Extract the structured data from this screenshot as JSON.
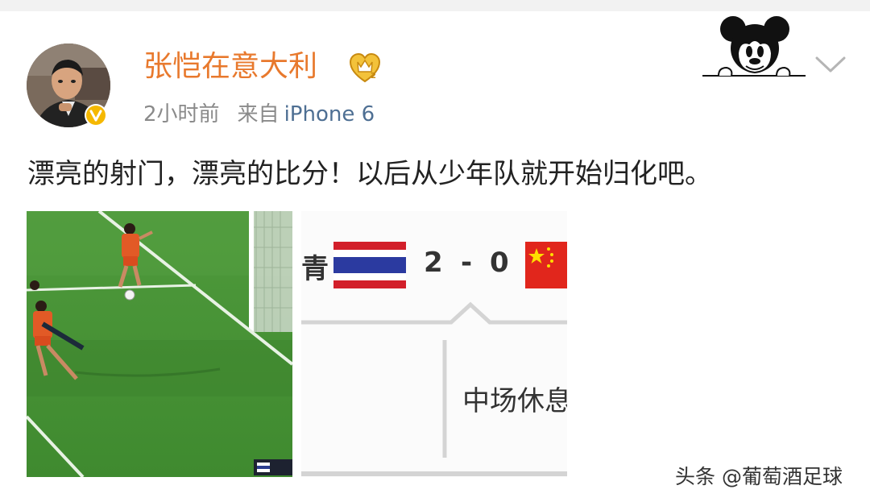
{
  "post": {
    "author": "张恺在意大利",
    "time": "2小时前",
    "source_prefix": "来自",
    "device": "iPhone 6",
    "text": "漂亮的射门，漂亮的比分！以后从少年队就开始归化吧。"
  },
  "scoreboard": {
    "team_partial": "青",
    "home_score": "2",
    "separator": "-",
    "away_score": "0",
    "status": "中场休息"
  },
  "watermark": "头条 @葡萄酒足球",
  "icons": {
    "verified": "verified-badge-icon",
    "crown": "vip-crown-icon",
    "more": "chevron-down-icon",
    "sticker": "mickey-sticker-icon"
  },
  "colors": {
    "author": "#e8792d",
    "device_link": "#4e6f93",
    "meta": "#8a8a8a",
    "verified": "#f5b800"
  }
}
